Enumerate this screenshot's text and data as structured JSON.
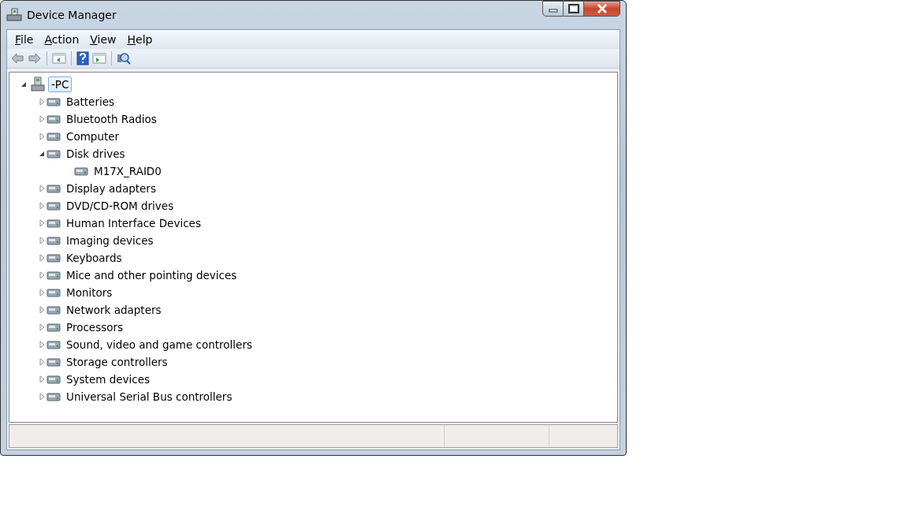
{
  "window": {
    "title": "Device Manager"
  },
  "menu": [
    {
      "accel": "F",
      "rest": "ile"
    },
    {
      "accel": "A",
      "rest": "ction"
    },
    {
      "accel": "V",
      "rest": "iew"
    },
    {
      "accel": "H",
      "rest": "elp"
    }
  ],
  "tree": [
    {
      "label": "-PC",
      "expanded": true,
      "selected": true,
      "children": [
        {
          "label": "Batteries",
          "expanded": false,
          "selected": false
        },
        {
          "label": "Bluetooth Radios",
          "expanded": false,
          "selected": false
        },
        {
          "label": "Computer",
          "expanded": false,
          "selected": false
        },
        {
          "label": "Disk drives",
          "expanded": true,
          "selected": false,
          "children": [
            {
              "label": "M17X_RAID0",
              "selected": false
            }
          ]
        },
        {
          "label": "Display adapters",
          "expanded": false,
          "selected": false
        },
        {
          "label": "DVD/CD-ROM drives",
          "expanded": false,
          "selected": false
        },
        {
          "label": "Human Interface Devices",
          "expanded": false,
          "selected": false
        },
        {
          "label": "Imaging devices",
          "expanded": false,
          "selected": false
        },
        {
          "label": "Keyboards",
          "expanded": false,
          "selected": false
        },
        {
          "label": "Mice and other pointing devices",
          "expanded": false,
          "selected": false
        },
        {
          "label": "Monitors",
          "expanded": false,
          "selected": false
        },
        {
          "label": "Network adapters",
          "expanded": false,
          "selected": false
        },
        {
          "label": "Processors",
          "expanded": false,
          "selected": false
        },
        {
          "label": "Sound, video and game controllers",
          "expanded": false,
          "selected": false
        },
        {
          "label": "Storage controllers",
          "expanded": false,
          "selected": false
        },
        {
          "label": "System devices",
          "expanded": false,
          "selected": false
        },
        {
          "label": "Universal Serial Bus controllers",
          "expanded": false,
          "selected": false
        }
      ]
    }
  ]
}
